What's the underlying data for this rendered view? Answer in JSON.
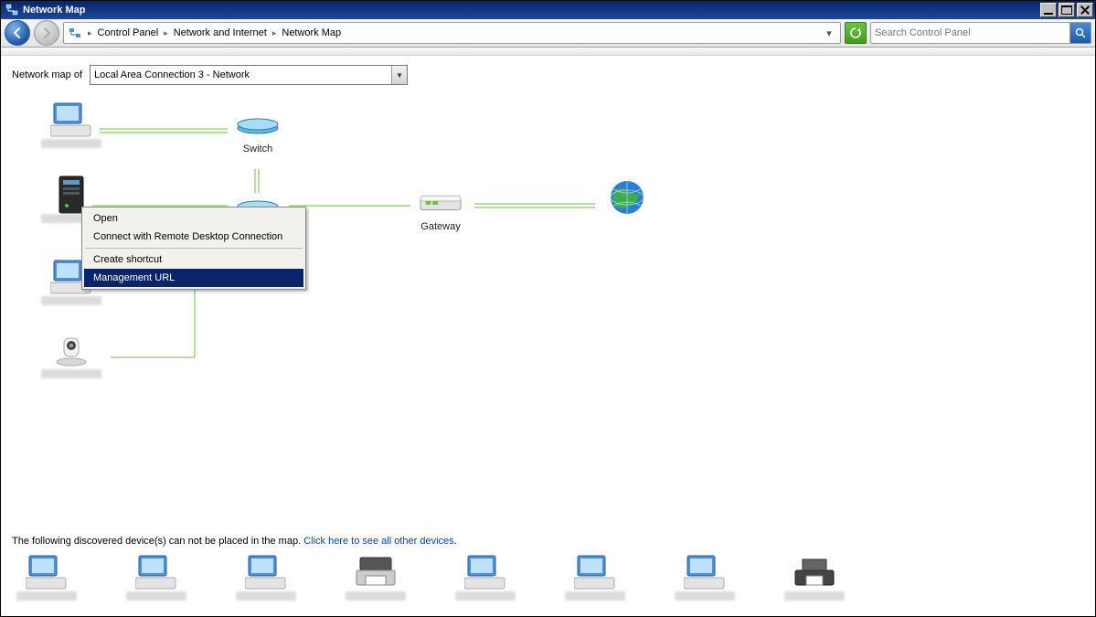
{
  "window": {
    "title": "Network Map"
  },
  "breadcrumb": {
    "root": "Control Panel",
    "l1": "Network and Internet",
    "l2": "Network Map"
  },
  "search": {
    "placeholder": "Search Control Panel"
  },
  "selector": {
    "label": "Network map of",
    "value": "Local Area Connection 3 - Network"
  },
  "nodes": {
    "switch": "Switch",
    "gateway": "Gateway"
  },
  "context_menu": {
    "open": "Open",
    "rdc": "Connect with Remote Desktop Connection",
    "shortcut": "Create shortcut",
    "mgmt": "Management URL"
  },
  "footer": {
    "prefix": "The following discovered device(s) can not be placed in the map. ",
    "link": "Click here to see all other devices",
    "suffix": "."
  }
}
